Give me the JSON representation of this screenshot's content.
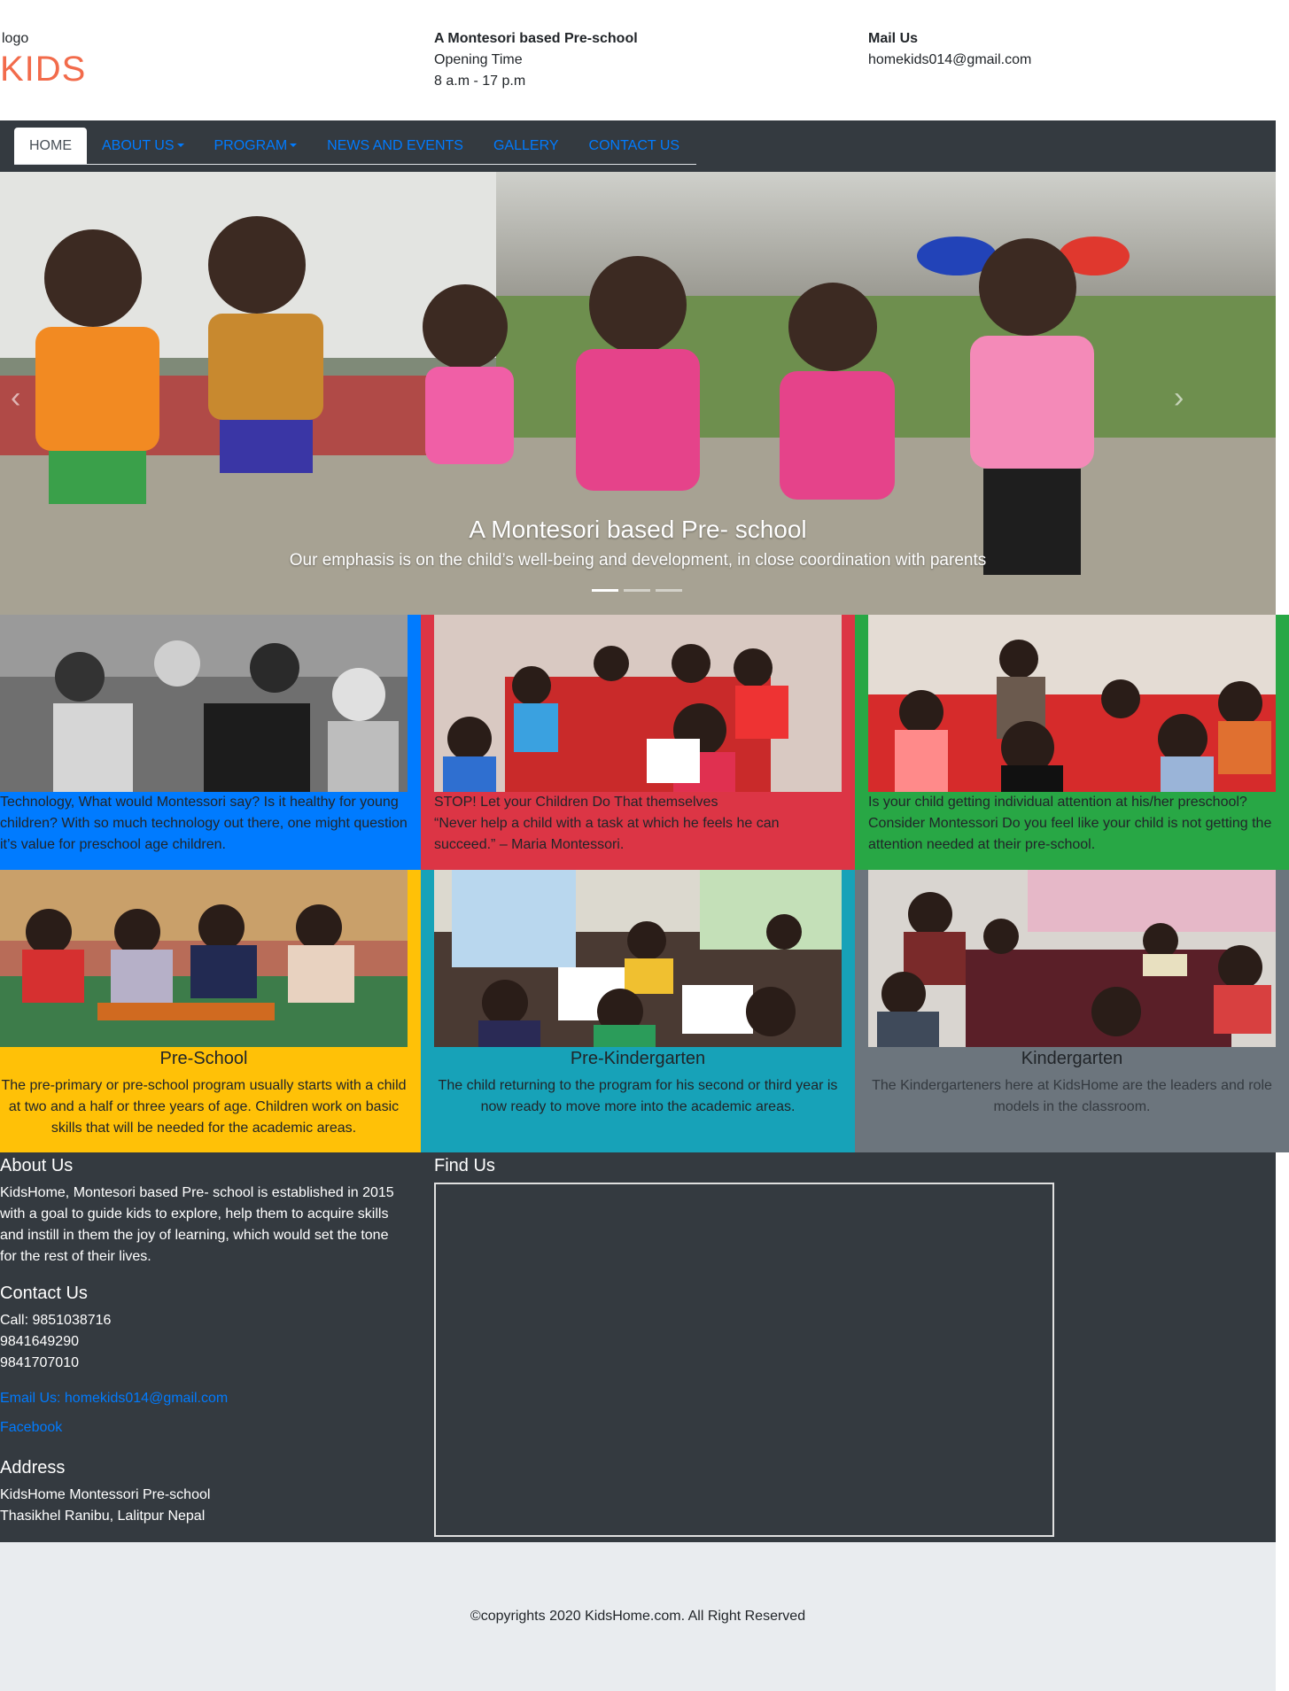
{
  "header": {
    "logo_alt": "logo",
    "logo_text": "KIDS",
    "col2_title": "A Montesori based Pre-school",
    "col2_line1": "Opening Time",
    "col2_line2": "8 a.m - 17 p.m",
    "col3_title": "Mail Us",
    "col3_line1": "homekids014@gmail.com"
  },
  "nav": {
    "items": [
      {
        "label": "HOME"
      },
      {
        "label": "ABOUT US"
      },
      {
        "label": "PROGRAM"
      },
      {
        "label": "NEWS AND EVENTS"
      },
      {
        "label": "GALLERY"
      },
      {
        "label": "CONTACT US"
      }
    ]
  },
  "carousel": {
    "title": "A Montesori based Pre- school",
    "text": "Our emphasis is on the child’s well-being and development, in close coordination with parents",
    "slides": 3,
    "active": 0
  },
  "articles": [
    {
      "text": "Technology, What would Montessori say? Is it healthy for young children? With so much technology out there, one might question it’s value for preschool age children.",
      "color": "#007bff"
    },
    {
      "text": "STOP! Let your Children Do That themselves\n“Never help a child with a task at which he feels he can succeed.” – Maria Montessori.",
      "color": "#dc3545"
    },
    {
      "text": "Is your child getting individual attention at his/her preschool? Consider Montessori Do you feel like your child is not getting the attention needed at their pre-school.",
      "color": "#28a745"
    }
  ],
  "programs": [
    {
      "title": "Pre-School",
      "text": "The pre-primary or pre-school program usually starts with a child at two and a half or three years of age. Children work on basic skills that will be needed for the academic areas.",
      "color": "#ffc107"
    },
    {
      "title": "Pre-Kindergarten",
      "text": "The child returning to the program for his second or third year is now ready to move more into the academic areas.",
      "color": "#17a2b8"
    },
    {
      "title": "Kindergarten",
      "text": "The Kindergarteners here at KidsHome are the leaders and role models in the classroom.",
      "color": "#6c757d"
    }
  ],
  "footer": {
    "about_title": "About Us",
    "about_text": "KidsHome, Montesori based Pre- school is established in 2015 with a goal to guide kids to explore, help them to acquire skills and instill in them the joy of learning, which would set the tone for the rest of their lives.",
    "contact_title": "Contact Us",
    "call_1": "Call: 9851038716",
    "call_2": "9841649290",
    "call_3": "9841707010",
    "email_link": "Email Us: homekids014@gmail.com",
    "facebook_link": "Facebook",
    "address_title": "Address",
    "address_1": "KidsHome Montessori Pre-school",
    "address_2": "Thasikhel Ranibu, Lalitpur Nepal",
    "find_title": "Find Us",
    "copyright": "©copyrights 2020 KidsHome.com. All Right Reserved"
  }
}
